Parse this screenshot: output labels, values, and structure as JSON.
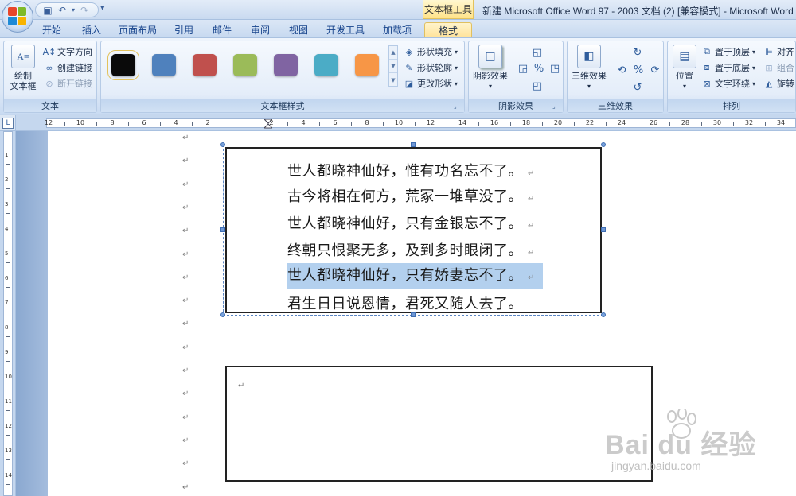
{
  "app": {
    "window_title": "新建 Microsoft Office Word 97 - 2003 文档 (2) [兼容模式] - Microsoft Word",
    "context_tab_title": "文本框工具"
  },
  "quick_access": {
    "icons": [
      "save-icon",
      "undo-icon",
      "redo-icon"
    ],
    "customize": "▾"
  },
  "tabs": [
    "开始",
    "插入",
    "页面布局",
    "引用",
    "邮件",
    "审阅",
    "视图",
    "开发工具",
    "加载项",
    "格式"
  ],
  "active_tab": "格式",
  "ribbon": {
    "text_group": {
      "label": "文本",
      "draw_textbox": "绘制\n文本框",
      "text_direction": "文字方向",
      "create_link": "创建链接",
      "break_link": "断开链接"
    },
    "textbox_styles_group": {
      "label": "文本框样式",
      "swatches": [
        "#0a0a0a",
        "#4f81bd",
        "#c0504d",
        "#9bbb59",
        "#8064a2",
        "#4bacc6",
        "#f79646"
      ],
      "shape_fill": "形状填充",
      "shape_outline": "形状轮廓",
      "change_shape": "更改形状"
    },
    "shadow_group": {
      "label": "阴影效果",
      "button": "阴影效果"
    },
    "threed_group": {
      "label": "三维效果",
      "button": "三维效果"
    },
    "arrange_group": {
      "label": "排列",
      "position": "位置",
      "bring_to_front": "置于顶层",
      "send_to_back": "置于底层",
      "text_wrapping": "文字环绕",
      "align": "对齐",
      "group": "组合",
      "rotate": "旋转"
    }
  },
  "ruler": {
    "numbers": [
      "12",
      "10",
      "8",
      "6",
      "4",
      "2",
      "",
      "2",
      "4",
      "6",
      "8",
      "10",
      "12",
      "14",
      "16",
      "18",
      "20",
      "22",
      "24",
      "26",
      "28",
      "30",
      "32",
      "34"
    ],
    "vertical_numbers": [
      "1",
      "2",
      "3",
      "4",
      "5",
      "6",
      "7",
      "8",
      "9",
      "10",
      "11",
      "12",
      "13",
      "14"
    ]
  },
  "document": {
    "paragraph_mark": "↵",
    "textbox1_lines": [
      "世人都晓神仙好，惟有功名忘不了。",
      "古今将相在何方，荒冢一堆草没了。",
      "世人都晓神仙好，只有金银忘不了。",
      "终朝只恨聚无多，及到多时眼闭了。",
      "世人都晓神仙好，只有娇妻忘不了。",
      "君生日日说恩情，君死又随人去了。"
    ],
    "selected_line_index": 4
  },
  "watermark": {
    "text": "Bai du 经验",
    "url": "jingyan.baidu.com"
  }
}
